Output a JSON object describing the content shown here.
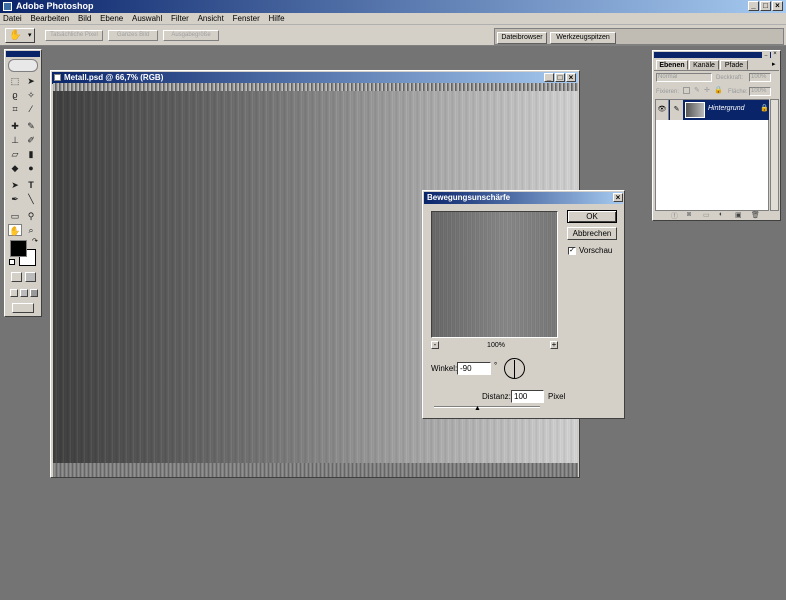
{
  "app": {
    "title": "Adobe Photoshop"
  },
  "menu": [
    "Datei",
    "Bearbeiten",
    "Bild",
    "Ebene",
    "Auswahl",
    "Filter",
    "Ansicht",
    "Fenster",
    "Hilfe"
  ],
  "options_bar": {
    "buttons": [
      "Tatsächliche Pixel",
      "Ganzes Bild",
      "Ausgabegröße"
    ],
    "tabs": [
      "Dateibrowser",
      "Werkzeugspitzen"
    ]
  },
  "document": {
    "title": "Metall.psd @ 66,7% (RGB)"
  },
  "dialog": {
    "title": "Bewegungsunschärfe",
    "ok_label": "OK",
    "cancel_label": "Abbrechen",
    "preview_label": "Vorschau",
    "preview_checked": true,
    "zoom": "100%",
    "zoom_out": "-",
    "zoom_in": "+",
    "angle_label": "Winkel:",
    "angle_value": "-90",
    "angle_unit": "°",
    "distance_label": "Distanz:",
    "distance_value": "100",
    "distance_unit": "Pixel"
  },
  "layers_panel": {
    "tabs": [
      "Ebenen",
      "Kanäle",
      "Pfade"
    ],
    "blend_mode": "Normal",
    "opacity_label": "Deckkraft:",
    "opacity_value": "100%",
    "lock_label": "Fixieren:",
    "fill_label": "Fläche:",
    "fill_value": "100%",
    "layer_name": "Hintergrund"
  },
  "colors": {
    "titlebar": "#0a246a",
    "chrome": "#d4d0c8",
    "workspace": "#747474",
    "selection": "#0a246a"
  }
}
